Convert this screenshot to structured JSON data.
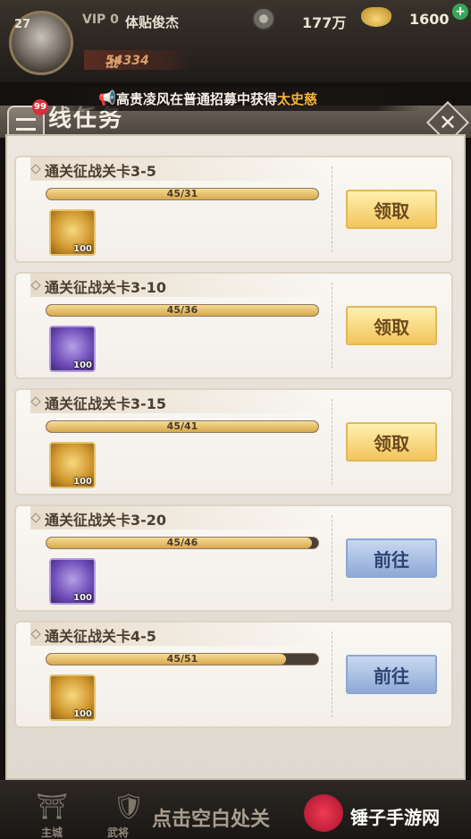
{
  "hud": {
    "level": "27",
    "vip": "VIP 0",
    "player_name": "体贴俊杰",
    "coins": "177万",
    "ingots": "1600",
    "power_label": "战",
    "power_value": "54334",
    "plus": "+"
  },
  "notice": {
    "prefix": "高贵凌风在普通招募中获得",
    "highlight": "太史慈"
  },
  "modal": {
    "title": "线任务",
    "badge_count": "99",
    "close": "✕"
  },
  "tasks": [
    {
      "title": "通关征战关卡3-5",
      "progress_text": "45/31",
      "progress": 1.0,
      "reward_type": "gold-ingot",
      "reward_count": "100",
      "action": "领取"
    },
    {
      "title": "通关征战关卡3-10",
      "progress_text": "45/36",
      "progress": 1.0,
      "reward_type": "purple-crystal",
      "reward_count": "100",
      "action": "领取"
    },
    {
      "title": "通关征战关卡3-15",
      "progress_text": "45/41",
      "progress": 1.0,
      "reward_type": "gold-ingot",
      "reward_count": "100",
      "action": "领取"
    },
    {
      "title": "通关征战关卡3-20",
      "progress_text": "45/46",
      "progress": 0.978,
      "reward_type": "purple-crystal",
      "reward_count": "100",
      "action": "前往"
    },
    {
      "title": "通关征战关卡4-5",
      "progress_text": "45/51",
      "progress": 0.882,
      "reward_type": "gold-ingot",
      "reward_count": "100",
      "action": "前往"
    }
  ],
  "nav": {
    "items": [
      "主城",
      "武将"
    ],
    "hint": "点击空白处关"
  },
  "watermark": "锤子手游网"
}
